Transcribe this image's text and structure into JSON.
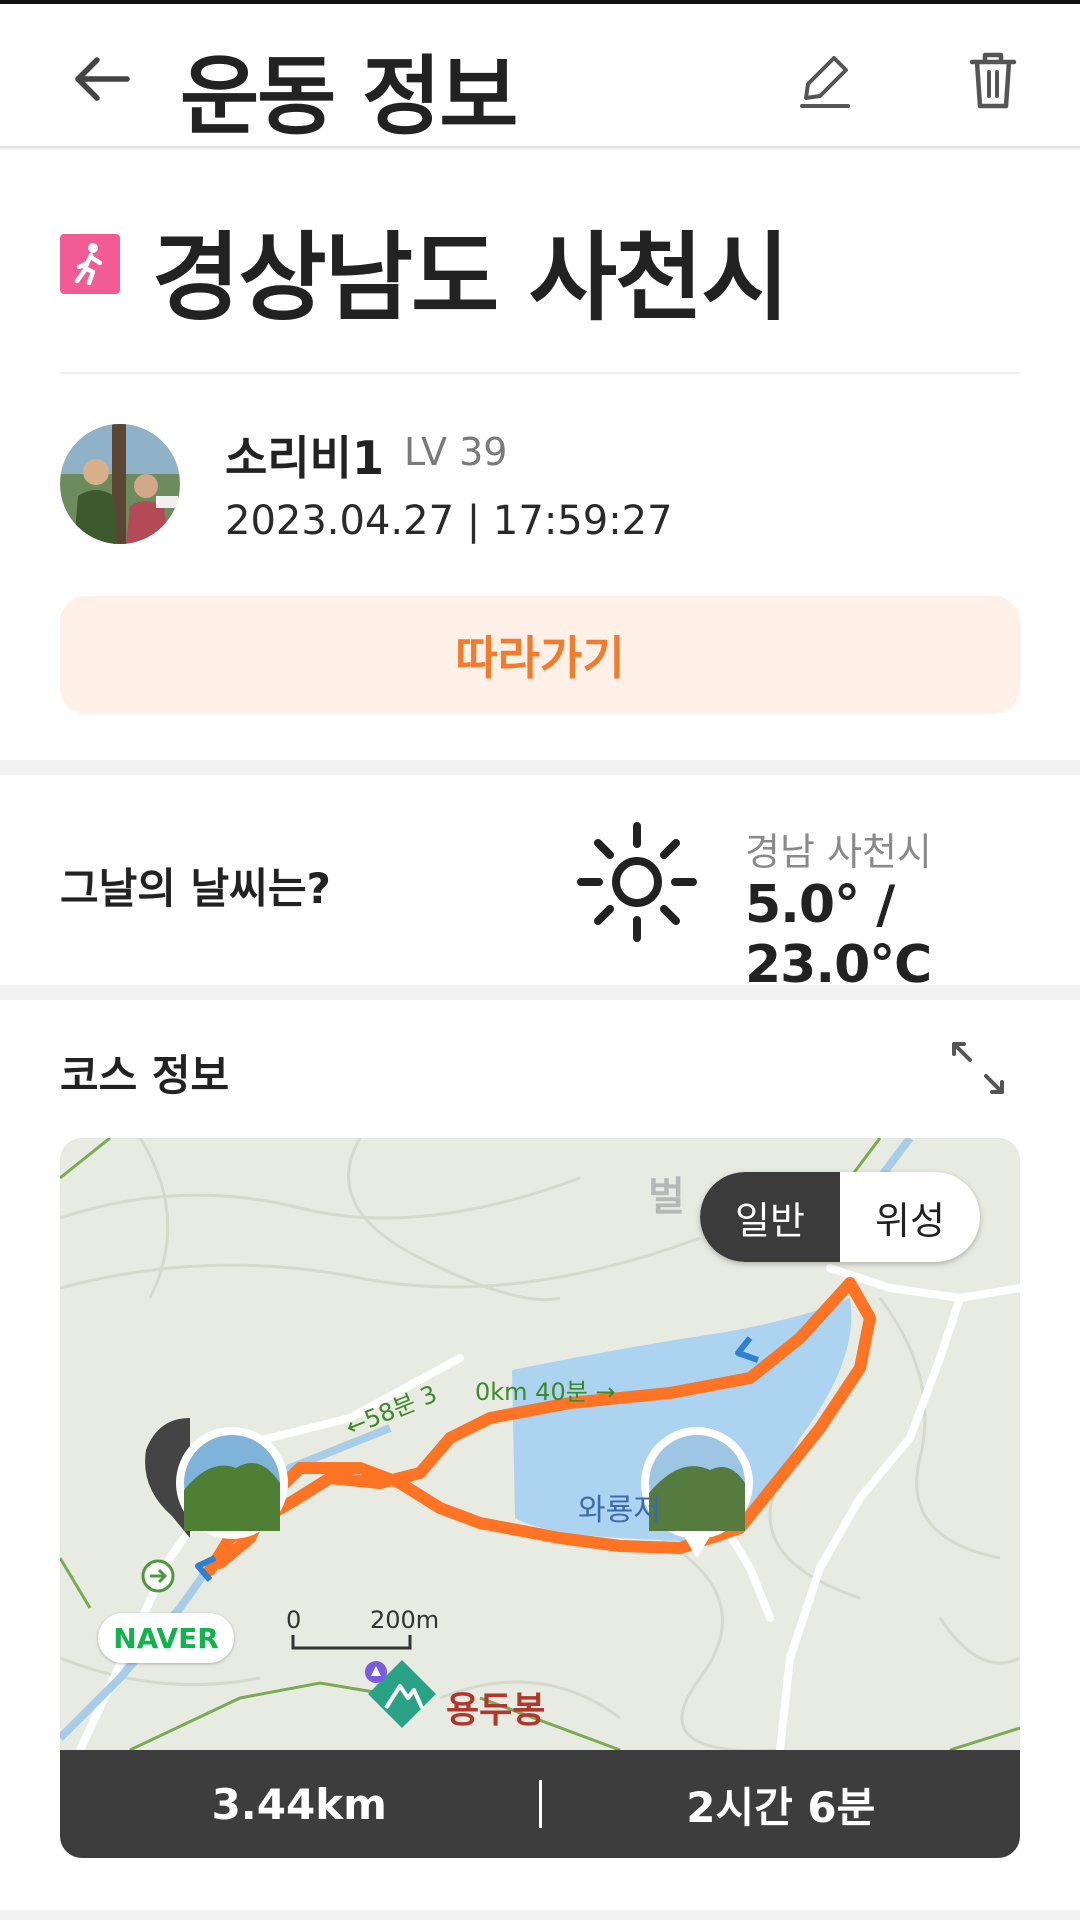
{
  "header": {
    "title": "운동 정보"
  },
  "activity": {
    "place": "경상남도 사천시"
  },
  "user": {
    "name": "소리비1",
    "level": "LV 39",
    "datetime": "2023.04.27 | 17:59:27"
  },
  "follow_button": {
    "label": "따라가기"
  },
  "weather": {
    "question": "그날의 날씨는?",
    "location": "경남 사천시",
    "temperature": "5.0° / 23.0℃"
  },
  "course": {
    "title": "코스 정보",
    "map_labels": {
      "place_top": "벌",
      "lake": "와룡저",
      "peak": "용두봉",
      "time_tag": "←58분 3",
      "dist_tag": "0km 40분 →",
      "scale_zero": "0",
      "scale_distance": "200m",
      "naver": "NAVER"
    },
    "map_toggle": {
      "normal": "일반",
      "satellite": "위성"
    },
    "distance": "3.44km",
    "duration": "2시간 6분"
  },
  "colors": {
    "accent": "#f47a2c",
    "follow_bg": "#fff1e8",
    "route": "#ff7424",
    "walk_badge": "#f25b93",
    "stats_bg": "#3d3d3d"
  }
}
